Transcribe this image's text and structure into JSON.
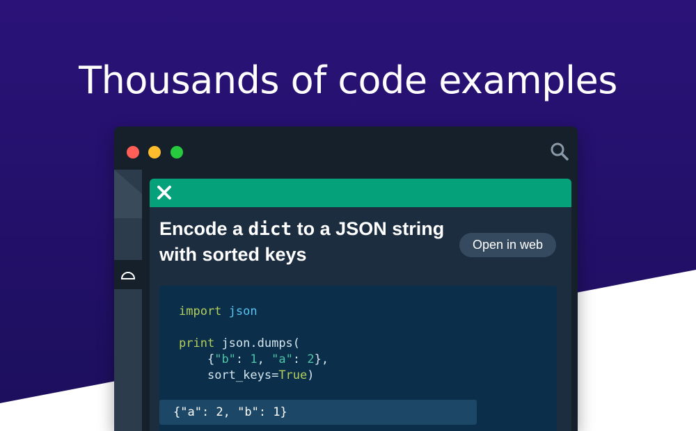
{
  "headline": "Thousands of code examples",
  "window": {
    "controls": [
      "close",
      "minimize",
      "maximize"
    ],
    "search_icon": "search-icon",
    "sidebar_icon": "half-circle-icon"
  },
  "card": {
    "close_icon": "close-icon",
    "title_prefix": "Encode a ",
    "title_code": "dict",
    "title_suffix": " to a JSON string with sorted keys",
    "open_button": "Open in web"
  },
  "code": {
    "line1_kw": "import",
    "line1_mod": "json",
    "line2_kw": "print",
    "line2_call": "json.dumps(",
    "line3_open": "{",
    "line3_key_b": "\"b\"",
    "line3_colon1": ": ",
    "line3_val_1": "1",
    "line3_sep": ", ",
    "line3_key_a": "\"a\"",
    "line3_colon2": ": ",
    "line3_val_2": "2",
    "line3_close": "},",
    "line4_arg": "sort_keys=",
    "line4_val": "True",
    "line4_close": ")"
  },
  "output": "{\"a\": 2, \"b\": 1}",
  "colors": {
    "background_purple": "#26116e",
    "accent_green": "#04a17b",
    "keyword": "#b4cf5a",
    "identifier": "#57c3f0",
    "literal": "#4fc3a5"
  }
}
